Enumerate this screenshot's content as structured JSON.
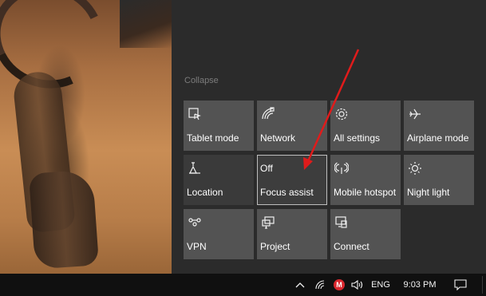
{
  "action_center": {
    "collapse_label": "Collapse",
    "tiles": [
      {
        "label": "Tablet mode",
        "icon": "tablet-mode-icon"
      },
      {
        "label": "Network",
        "icon": "network-icon"
      },
      {
        "label": "All settings",
        "icon": "settings-gear-icon"
      },
      {
        "label": "Airplane mode",
        "icon": "airplane-icon"
      },
      {
        "label": "Location",
        "icon": "location-icon"
      },
      {
        "label": "Focus assist",
        "status": "Off",
        "icon": "focus-assist-icon"
      },
      {
        "label": "Mobile hotspot",
        "icon": "hotspot-icon"
      },
      {
        "label": "Night light",
        "icon": "night-light-icon"
      },
      {
        "label": "VPN",
        "icon": "vpn-icon"
      },
      {
        "label": "Project",
        "icon": "project-icon"
      },
      {
        "label": "Connect",
        "icon": "connect-icon"
      }
    ]
  },
  "taskbar": {
    "language": "ENG",
    "time": "9:03 PM",
    "icons": [
      "chevron-up-icon",
      "wifi-icon",
      "mega-icon",
      "volume-icon",
      "notifications-icon"
    ]
  },
  "colors": {
    "tile": "#535353",
    "tile_dark": "#3a3a3a",
    "panel": "#2b2b2b",
    "taskbar": "#101010",
    "annotation_arrow": "#e01b1b",
    "mega_badge": "#d9272e"
  }
}
